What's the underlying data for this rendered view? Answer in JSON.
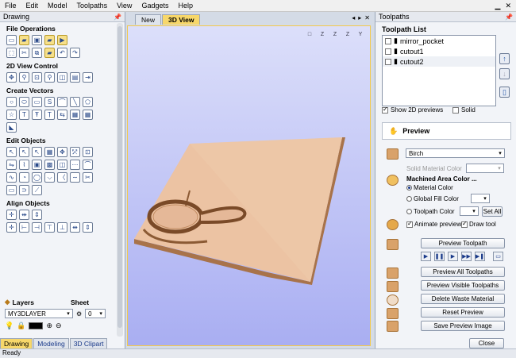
{
  "menu": [
    "File",
    "Edit",
    "Model",
    "Toolpaths",
    "View",
    "Gadgets",
    "Help"
  ],
  "left": {
    "title": "Drawing",
    "sections": {
      "file": "File Operations",
      "view2d": "2D View Control",
      "vectors": "Create Vectors",
      "edit": "Edit Objects",
      "align": "Align Objects"
    },
    "layers_label": "Layers",
    "sheet_label": "Sheet",
    "layer_value": "MY3DLAYER",
    "sheet_value": "0",
    "tabs": [
      "Drawing",
      "Modeling",
      "3D Clipart"
    ]
  },
  "center": {
    "tabs": [
      "New",
      "3D View"
    ],
    "view_icons": [
      "□",
      "Z",
      "Z",
      "Z",
      "Y"
    ]
  },
  "right": {
    "title": "Toolpaths",
    "list_title": "Toolpath List",
    "toolpaths": [
      "mirror_pocket",
      "cutout1",
      "cutout2"
    ],
    "show2d_label": "Show 2D previews",
    "solid_label": "Solid",
    "preview_label": "Preview",
    "material": "Birch",
    "solid_material_label": "Solid Material Color",
    "machined_label": "Machined Area Color ...",
    "material_color_label": "Material Color",
    "global_fill_label": "Global Fill Color",
    "toolpath_color_label": "Toolpath Color",
    "set_all_label": "Set All",
    "animate_label": "Animate preview",
    "draw_tool_label": "Draw tool",
    "buttons": {
      "preview_toolpath": "Preview Toolpath",
      "preview_all": "Preview All Toolpaths",
      "preview_visible": "Preview Visible Toolpaths",
      "delete_waste": "Delete Waste Material",
      "reset": "Reset Preview",
      "save_image": "Save Preview Image",
      "close": "Close"
    }
  },
  "status": "Ready",
  "colors": {
    "accent": "#f7d76a",
    "wood": "#e9b999",
    "view_top": "#dcdffa",
    "view_bottom": "#a9aef2"
  }
}
